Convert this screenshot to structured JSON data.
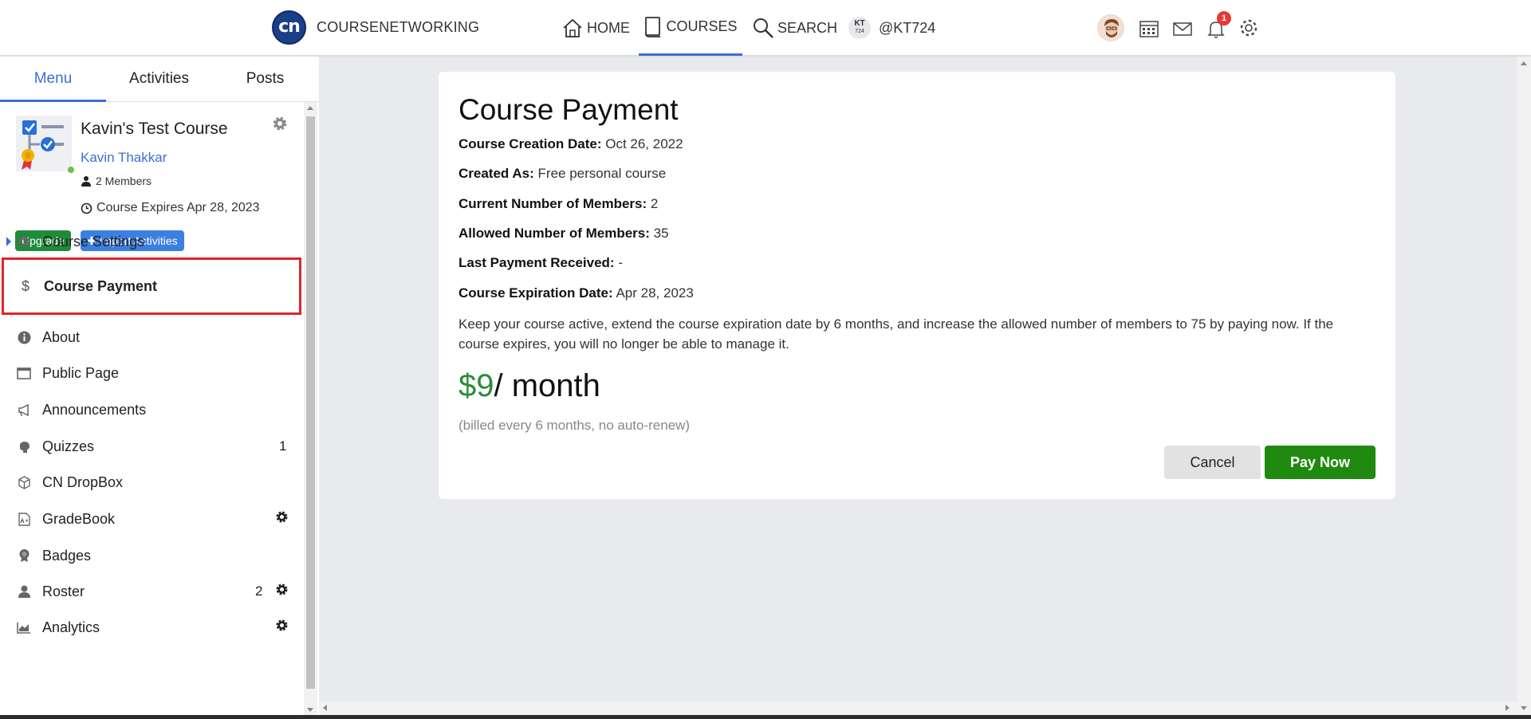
{
  "header": {
    "logo_text": "cn",
    "brand": "COURSENETWORKING",
    "nav": {
      "home": "HOME",
      "courses": "COURSES",
      "search": "SEARCH",
      "user_initials": "KT",
      "user_sub": "724",
      "username": "@KT724"
    },
    "notification_count": "1"
  },
  "sidebar": {
    "tabs": [
      "Menu",
      "Activities",
      "Posts"
    ],
    "course": {
      "title": "Kavin's Test Course",
      "owner": "Kavin Thakkar",
      "members": "2 Members",
      "expires": "Course Expires Apr 28, 2023",
      "upgrade_label": "Upgrade",
      "import_label": "Import Activities"
    },
    "items": [
      {
        "label": "Course Settings",
        "icon": "gear-icon"
      },
      {
        "label": "Course Payment",
        "icon": "dollar-icon"
      },
      {
        "label": "About",
        "icon": "info-icon"
      },
      {
        "label": "Public Page",
        "icon": "window-icon"
      },
      {
        "label": "Announcements",
        "icon": "megaphone-icon"
      },
      {
        "label": "Quizzes",
        "icon": "brain-icon",
        "count": "1"
      },
      {
        "label": "CN DropBox",
        "icon": "box-icon"
      },
      {
        "label": "GradeBook",
        "icon": "gradebook-icon"
      },
      {
        "label": "Badges",
        "icon": "badge-icon"
      },
      {
        "label": "Roster",
        "icon": "person-icon",
        "count": "2"
      },
      {
        "label": "Analytics",
        "icon": "chart-icon"
      }
    ]
  },
  "payment": {
    "title": "Course Payment",
    "rows": [
      {
        "label": "Course Creation Date:",
        "value": "Oct 26, 2022"
      },
      {
        "label": "Created As:",
        "value": "Free personal course"
      },
      {
        "label": "Current Number of Members:",
        "value": "2"
      },
      {
        "label": "Allowed Number of Members:",
        "value": "35"
      },
      {
        "label": "Last Payment Received:",
        "value": "-"
      },
      {
        "label": "Course Expiration Date:",
        "value": "Apr 28, 2023"
      }
    ],
    "description": "Keep your course active, extend the course expiration date by 6 months, and increase the allowed number of members to 75 by paying now. If the course expires, you will no longer be able to manage it.",
    "price_amount": "$9",
    "price_period": "/ month",
    "billing_note": "(billed every 6 months, no auto-renew)",
    "cancel_label": "Cancel",
    "pay_label": "Pay Now"
  },
  "colors": {
    "accent": "#3b6fd4",
    "pay_green": "#1f8a0f",
    "highlight_red": "#e3242b"
  }
}
